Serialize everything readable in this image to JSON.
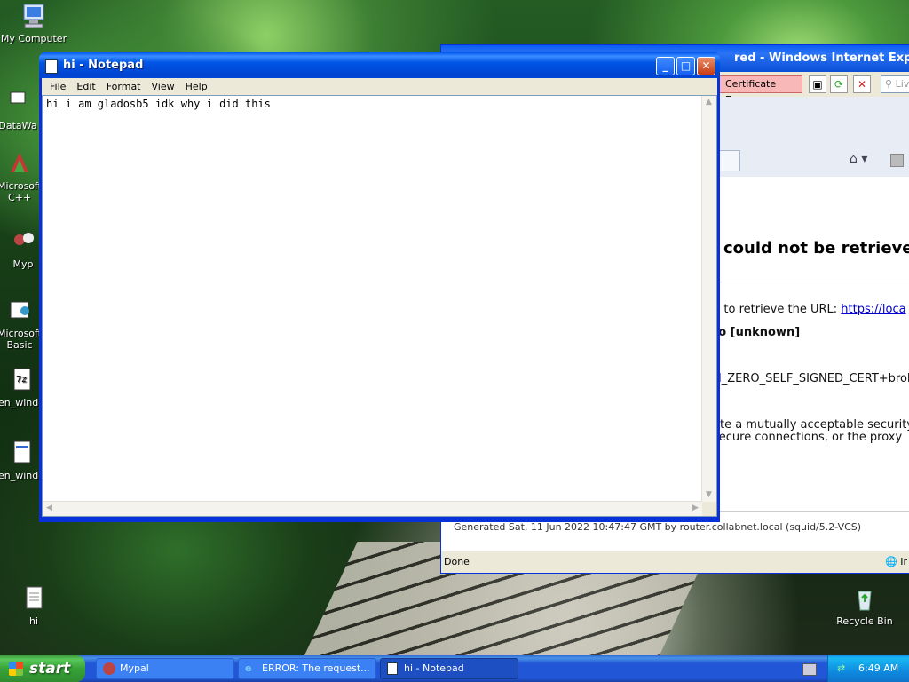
{
  "desktop_icons": {
    "my_computer": "My Computer",
    "datawarehouse": "DataWa",
    "msvc_line1": "Microsoft",
    "msvc_line2": "C++",
    "mypal": "Myp",
    "msvb_line1": "Microsoft",
    "msvb_line2": "Basic",
    "en_windows_1": "en_winde",
    "en_windows_2": "en_winde",
    "hi_file": "hi",
    "recycle_bin": "Recycle Bin"
  },
  "ie_window": {
    "title": "red - Windows Internet Explorer",
    "cert_error": "Certificate Error",
    "search_placeholder": "Liv",
    "error_title": "could not be retrieve",
    "line1_prefix": "g to retrieve the URL: ",
    "line1_link": "https://loca",
    "line2": "to [unknown]",
    "line3": "H_ZERO_SELF_SIGNED_CERT+brol",
    "line4": "ate a mutually acceptable security",
    "line5": " secure connections, or the proxy",
    "generated": "Generated Sat, 11 Jun 2022 10:47:47 GMT by router.collabnet.local (squid/5.2-VCS)",
    "status": "Done",
    "zone": "Ir"
  },
  "notepad": {
    "title": "hi - Notepad",
    "menu": [
      "File",
      "Edit",
      "Format",
      "View",
      "Help"
    ],
    "content": "hi i am gladosb5 idk why i did this"
  },
  "taskbar": {
    "start": "start",
    "tasks": [
      "Mypal",
      "ERROR: The request...",
      "hi - Notepad"
    ],
    "clock": "6:49 AM"
  }
}
